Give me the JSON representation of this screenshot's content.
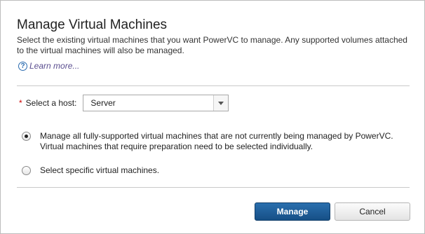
{
  "dialog": {
    "title": "Manage Virtual Machines",
    "description": "Select the existing virtual machines that you want PowerVC to manage. Any supported volumes attached to the virtual machines will also be managed.",
    "learn_more": "Learn more...",
    "help_icon": "question-circle-icon"
  },
  "host": {
    "required_marker": "*",
    "label": "Select a host:",
    "selected": "Server"
  },
  "options": [
    {
      "label": "Manage all fully-supported virtual machines that are not currently being managed by PowerVC. Virtual machines that require preparation need to be selected individually.",
      "checked": true
    },
    {
      "label": "Select specific virtual machines.",
      "checked": false
    }
  ],
  "buttons": {
    "primary": "Manage",
    "secondary": "Cancel"
  }
}
